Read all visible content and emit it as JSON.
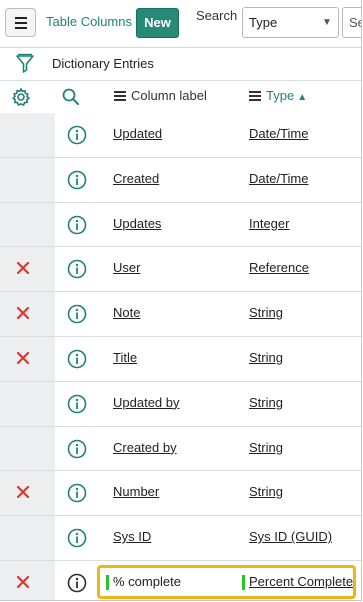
{
  "header": {
    "menu_icon": "hamburger-icon",
    "title": "Table Columns",
    "new_label": "New",
    "search_label": "Search",
    "search_field": {
      "selected": "Type",
      "caret": "▼"
    },
    "search_input_partial": "Se"
  },
  "filter": {
    "icon": "funnel-icon",
    "breadcrumb": "Dictionary Entries"
  },
  "columns": {
    "settings_icon": "gear-icon",
    "search_icon": "magnifier-icon",
    "label_header": "Column label",
    "type_header": "Type",
    "sort": "ascending",
    "sort_glyph": "▲"
  },
  "rows": [
    {
      "label": "Updated",
      "type": "Date/Time",
      "deletable": false
    },
    {
      "label": "Created",
      "type": "Date/Time",
      "deletable": false
    },
    {
      "label": "Updates",
      "type": "Integer",
      "deletable": false
    },
    {
      "label": "User",
      "type": "Reference",
      "deletable": true
    },
    {
      "label": "Note",
      "type": "String",
      "deletable": true
    },
    {
      "label": "Title",
      "type": "String",
      "deletable": true
    },
    {
      "label": "Updated by",
      "type": "String",
      "deletable": false
    },
    {
      "label": "Created by",
      "type": "String",
      "deletable": false
    },
    {
      "label": "Number",
      "type": "String",
      "deletable": true
    },
    {
      "label": "Sys ID",
      "type": "Sys ID (GUID)",
      "deletable": false
    }
  ],
  "new_row": {
    "label": "% complete",
    "type": "Percent Complete",
    "deletable": true
  },
  "colors": {
    "accent": "#1f8476",
    "delete": "#e0352b",
    "highlight": "#f0b417",
    "marker": "#2bc42b"
  }
}
